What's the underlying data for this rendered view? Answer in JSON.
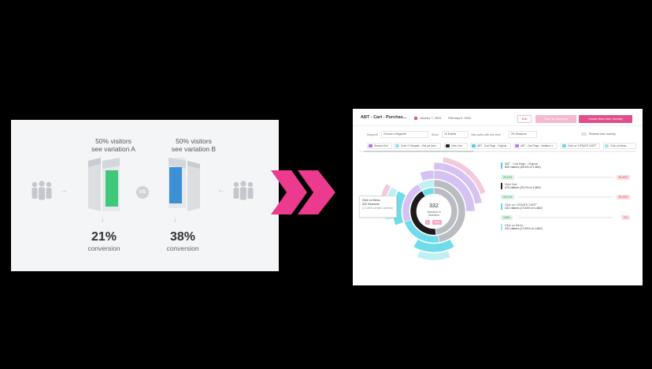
{
  "ab_test": {
    "variation_a": {
      "caption_line1": "50% visitors",
      "caption_line2": "see variation A",
      "conversion_pct": "21%",
      "conversion_label": "conversion",
      "accent_color": "#3fc77a"
    },
    "variation_b": {
      "caption_line1": "50% visitors",
      "caption_line2": "see variation B",
      "conversion_pct": "38%",
      "conversion_label": "conversion",
      "accent_color": "#3d8fd6"
    },
    "vs_label": "VS",
    "icons": [
      "users-group-icon",
      "arrow-right-icon",
      "arrow-left-icon",
      "arrow-down-icon"
    ]
  },
  "transition": {
    "icon": "double-chevron-right-icon",
    "color": "#ec3b8f"
  },
  "dashboard": {
    "title": "ABT - Cart - Purchas...",
    "date_start": "January 7, 2024",
    "date_end": "February 6, 2024",
    "edit_label": "Edit",
    "save_segment_label": "Save as Segment",
    "create_journey_label": "Create New User Journey",
    "accent_color": "#e04f8b",
    "filters": {
      "segment_label": "Segment",
      "segment_value": "Choose a Segment",
      "show_label": "Show",
      "show_value": "15 Events",
      "hide_label": "Hide paths with less than",
      "hide_value": "2% Sessions",
      "reverse_label": "Reverse User Journey"
    },
    "legend": [
      {
        "label": "Session Exit",
        "color": "#a678d8"
      },
      {
        "label": "Zone 3 Clickpath - Sell per Item",
        "color": "#8fe3ec"
      },
      {
        "label": "View Cart",
        "color": "#222222"
      },
      {
        "label": "ABT - Cart Page - Original",
        "color": "#5bc8e8"
      },
      {
        "label": "ABT - Cart Page - Variation 1",
        "color": "#b77fe0"
      },
      {
        "label": "Click on \"UPDATE CART\"",
        "color": "#67d9e6"
      },
      {
        "label": "Click on Menu...",
        "color": "#9ee6ef"
      }
    ],
    "tooltip": {
      "line1": "Click on Menu",
      "line2": "332 Sessions",
      "line3": "(17.83% of Mini Journey"
    },
    "center": {
      "count": "332",
      "line1": "Sessions in",
      "line2": "Selection",
      "btn_a": "1",
      "btn_b": "Sort"
    },
    "nodes": [
      {
        "name": "ABT - Cart Page - Original",
        "visitors": "849 visitors (45.6% of 1,862)",
        "color": "#5bc8e8",
        "up": "29.11%",
        "down": "30.40%"
      },
      {
        "name": "View Cart",
        "visitors": "470 visitors (25.2% of 1,862)",
        "color": "#222222",
        "up": "28.11%",
        "down": "30.41%"
      },
      {
        "name": "Click on \"UPDATE CART\"",
        "visitors": "332 visitors (17.83% of 1,862)",
        "color": "#67d9e6",
        "up": "100%",
        "down": "0%"
      },
      {
        "name": "Click on Menu...",
        "visitors": "332 visitors (17.83% of 1,862)",
        "color": "#9ee6ef"
      }
    ],
    "sunburst_colors": {
      "gray": "#b9bcc1",
      "purple": "#d6c2f2",
      "cyan": "#6fdcea",
      "light_cyan": "#bff0f5",
      "black": "#1c1c1c",
      "pink": "#f3c9dc"
    }
  }
}
